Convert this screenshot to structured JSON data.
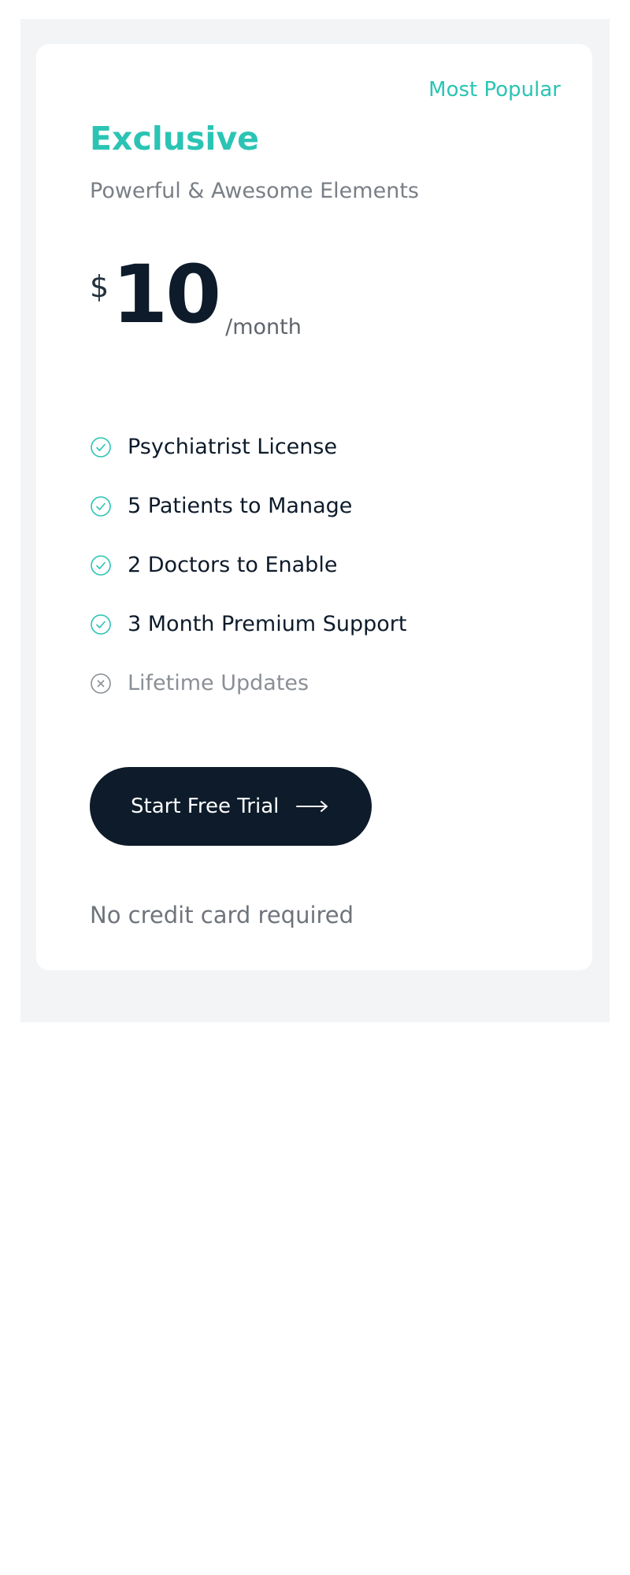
{
  "pricing": {
    "badge": "Most Popular",
    "plan_name": "Exclusive",
    "subtitle": "Powerful & Awesome Elements",
    "currency": "$",
    "amount": "10",
    "period": "/month",
    "features": [
      {
        "label": "Psychiatrist License",
        "included": true,
        "icon": "check-circle-icon"
      },
      {
        "label": "5 Patients to Manage",
        "included": true,
        "icon": "check-circle-icon"
      },
      {
        "label": "2 Doctors to Enable",
        "included": true,
        "icon": "check-circle-icon"
      },
      {
        "label": "3 Month Premium Support",
        "included": true,
        "icon": "check-circle-icon"
      },
      {
        "label": "Lifetime Updates",
        "included": false,
        "icon": "x-circle-icon"
      }
    ],
    "cta_label": "Start Free Trial",
    "cta_icon": "arrow-right-icon",
    "note": "No credit card required"
  },
  "colors": {
    "accent": "#2bc4b4",
    "dark": "#0d1b2a",
    "muted": "#8a8f96",
    "panel_bg": "#f2f4f6",
    "card_bg": "#ffffff"
  }
}
